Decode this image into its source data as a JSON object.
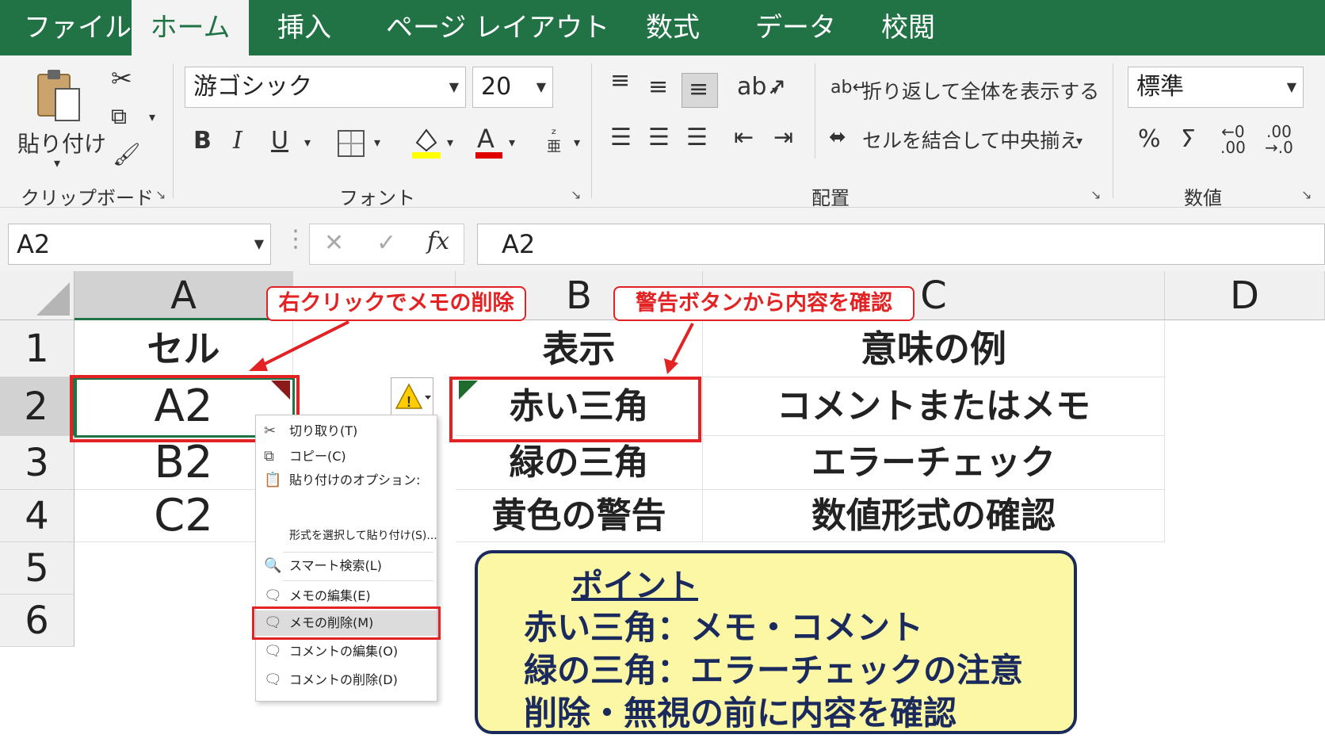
{
  "tabs": [
    "ファイル",
    "ホーム",
    "挿入",
    "ページ レイアウト",
    "数式",
    "データ",
    "校閲"
  ],
  "ribbon": {
    "paste_label": "貼り付け",
    "clipboard_label": "クリップボード",
    "font_name": "游ゴシック",
    "font_size": "20",
    "bold": "B",
    "italic": "I",
    "underline": "U",
    "font_color_glyph": "A",
    "font_label": "フォント",
    "wrap_text": "折り返して全体を表示する",
    "merge_center": "セルを結合して中央揃え",
    "alignment_label": "配置",
    "number_format": "標準",
    "percent": "%",
    "number_label": "数値"
  },
  "formula_bar": {
    "name_box": "A2",
    "formula": "A2"
  },
  "grid": {
    "columns": [
      "A",
      "B",
      "C",
      "D"
    ],
    "rows": [
      "1",
      "2",
      "3",
      "4",
      "5",
      "6"
    ],
    "cells": {
      "a1": "セル",
      "b1": "表示",
      "c1": "意味の例",
      "a2": "A2",
      "b2": "赤い三角",
      "c2": "コメントまたはメモ",
      "a3": "B2",
      "b3": "緑の三角",
      "c3": "エラーチェック",
      "a4": "C2",
      "b4": "黄色の警告",
      "c4": "数値形式の確認"
    }
  },
  "context_menu": {
    "items": [
      "切り取り(T)",
      "コピー(C)",
      "貼り付けのオプション:",
      "形式を選択して貼り付け(S)...",
      "スマート検索(L)",
      "メモの編集(E)",
      "メモの削除(M)",
      "コメントの編集(O)",
      "コメントの削除(D)"
    ]
  },
  "callouts": {
    "left": "右クリックでメモの削除",
    "right": "警告ボタンから内容を確認"
  },
  "point_box": {
    "title": "ポイント",
    "lines": [
      "赤い三角：メモ・コメント",
      "緑の三角：エラーチェックの注意",
      "削除・無視の前に内容を確認"
    ]
  },
  "colors": {
    "accent": "#217346",
    "annotation": "#e32323",
    "point_bg": "#fbf7a5",
    "point_border": "#1b2a5c"
  }
}
